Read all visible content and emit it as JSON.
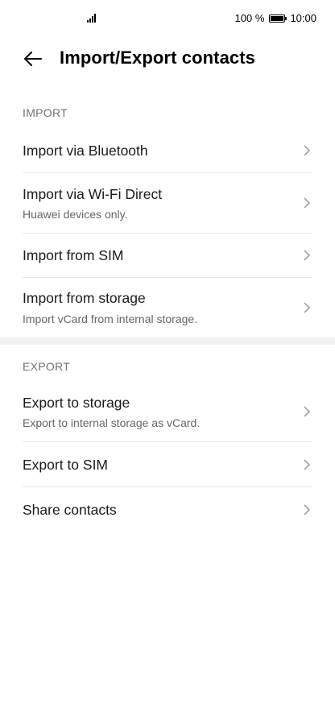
{
  "status_bar": {
    "signal_icon": "signal-bars-icon",
    "battery_percent": "100 %",
    "battery_level": 1.0,
    "time": "10:00"
  },
  "header": {
    "back_icon": "arrow-left-icon",
    "title": "Import/Export contacts"
  },
  "import_section": {
    "label": "IMPORT",
    "items": [
      {
        "title": "Import via Bluetooth",
        "subtitle": ""
      },
      {
        "title": "Import via Wi-Fi Direct",
        "subtitle": "Huawei devices only."
      },
      {
        "title": "Import from SIM",
        "subtitle": ""
      },
      {
        "title": "Import from storage",
        "subtitle": "Import vCard from internal storage."
      }
    ]
  },
  "export_section": {
    "label": "EXPORT",
    "items": [
      {
        "title": "Export to storage",
        "subtitle": "Export to internal storage as vCard."
      },
      {
        "title": "Export to SIM",
        "subtitle": ""
      },
      {
        "title": "Share contacts",
        "subtitle": ""
      }
    ]
  },
  "colors": {
    "background": "#ffffff",
    "section_label": "#737373",
    "subtitle": "#666666",
    "divider": "#e9e9e9",
    "band": "#f1f1f1"
  }
}
